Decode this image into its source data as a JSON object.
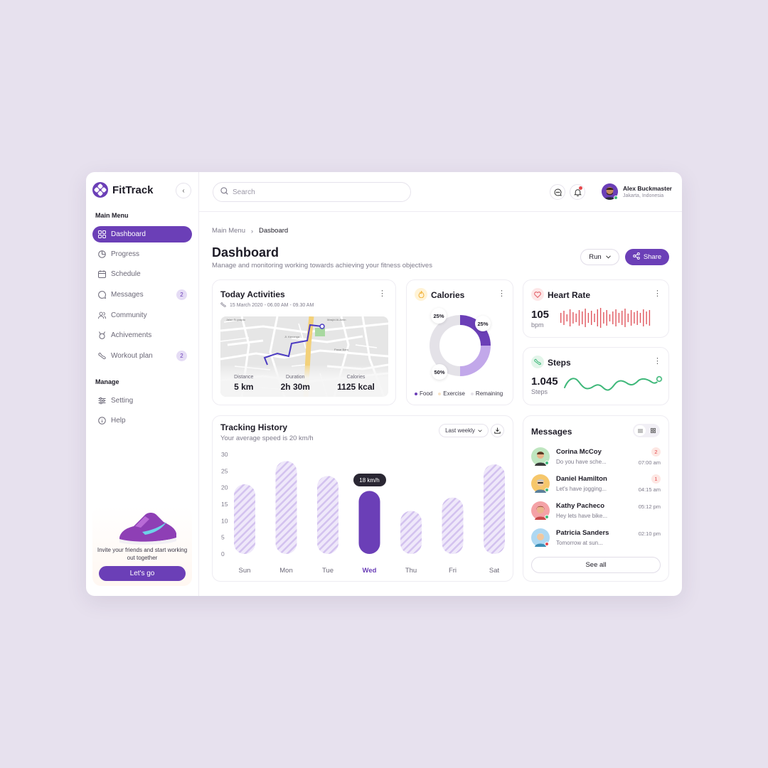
{
  "brand": {
    "name": "FitTrack"
  },
  "sidebar": {
    "main_heading": "Main Menu",
    "items": [
      {
        "label": "Dashboard",
        "icon": "grid-icon",
        "active": true
      },
      {
        "label": "Progress",
        "icon": "pie-chart-icon"
      },
      {
        "label": "Schedule",
        "icon": "calendar-icon"
      },
      {
        "label": "Messages",
        "icon": "chat-icon",
        "badge": "2"
      },
      {
        "label": "Community",
        "icon": "users-icon"
      },
      {
        "label": "Achivements",
        "icon": "medal-icon"
      },
      {
        "label": "Workout plan",
        "icon": "shoe-icon",
        "badge": "2"
      }
    ],
    "manage_heading": "Manage",
    "manage_items": [
      {
        "label": "Setting",
        "icon": "sliders-icon"
      },
      {
        "label": "Help",
        "icon": "info-icon"
      }
    ],
    "promo": {
      "text": "Invite your friends and start working out together",
      "button": "Let's go"
    }
  },
  "header": {
    "search_placeholder": "Search",
    "user": {
      "name": "Alex Buckmaster",
      "location": "Jakarta, Indonesia"
    }
  },
  "breadcrumb": {
    "root": "Main Menu",
    "current": "Dasboard"
  },
  "page": {
    "title": "Dashboard",
    "subtitle": "Manage and monitoring working towards achieving your fitness objectives",
    "activity_select": "Run",
    "share_label": "Share"
  },
  "today": {
    "title": "Today Activities",
    "meta": "15 March 2020 - 06.00 AM - 09.30 AM",
    "stats": [
      {
        "label": "Distance",
        "value": "5 km"
      },
      {
        "label": "Duration",
        "value": "2h 30m"
      },
      {
        "label": "Calories",
        "value": "1125 kcal"
      }
    ]
  },
  "calories": {
    "title": "Calories",
    "slices": [
      {
        "name": "Food",
        "value": 25,
        "label": "25%",
        "color": "#6B3FB7"
      },
      {
        "name": "Exercise",
        "value": 25,
        "label": "25%",
        "color": "#C2A8EA"
      },
      {
        "name": "Remaining",
        "value": 50,
        "label": "50%",
        "color": "#E4E2E8"
      }
    ]
  },
  "heart": {
    "title": "Heart Rate",
    "value": "105",
    "unit": "bpm",
    "color": "#E0565E"
  },
  "steps": {
    "title": "Steps",
    "value": "1.045",
    "unit": "Steps",
    "color": "#3FB87A"
  },
  "tracking": {
    "title": "Tracking History",
    "subtitle": "Your average speed is 20 km/h",
    "period": "Last weekly",
    "tooltip": "18 km/h"
  },
  "chart_data": {
    "type": "bar",
    "categories": [
      "Sun",
      "Mon",
      "Tue",
      "Wed",
      "Thu",
      "Fri",
      "Sat"
    ],
    "values": [
      21,
      28,
      23.5,
      19,
      13,
      17,
      27
    ],
    "highlight": "Wed",
    "yticks": [
      "30",
      "25",
      "20",
      "15",
      "10",
      "5",
      "0"
    ],
    "ylim": [
      0,
      30
    ],
    "grid": false
  },
  "messages": {
    "title": "Messages",
    "items": [
      {
        "name": "Corina McCoy",
        "preview": "Do you have sche...",
        "time": "07:00 am",
        "badge": "2",
        "avatar_bg": "#BFE6C0",
        "status": "#3FB87A"
      },
      {
        "name": "Daniel Hamilton",
        "preview": "Let's have jogging...",
        "time": "04:15 am",
        "badge": "1",
        "avatar_bg": "#F6C76B",
        "status": "#3FB87A"
      },
      {
        "name": "Kathy Pacheco",
        "preview": "Hey lets have bike...",
        "time": "05:12 pm",
        "badge": "",
        "avatar_bg": "#F4A2A6",
        "status": "#3FB87A"
      },
      {
        "name": "Patricia Sanders",
        "preview": "Tomorrow at sun...",
        "time": "02:10 pm",
        "badge": "",
        "avatar_bg": "#AED8F2",
        "status": "#E5484D"
      }
    ],
    "see_all": "See all"
  },
  "colors": {
    "primary": "#6B3FB7",
    "primary_light": "#E5DCF5"
  }
}
